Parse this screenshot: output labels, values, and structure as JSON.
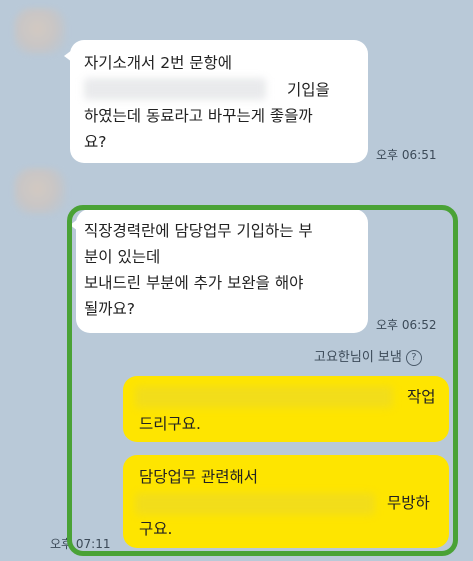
{
  "messages": [
    {
      "lines": [
        "자기소개서 2번 문항에",
        "기입을",
        "하였는데 동료라고 바꾸는게 좋을까",
        "요?"
      ],
      "time": "오후 06:51"
    },
    {
      "lines": [
        "직장경력란에 담당업무 기입하는 부",
        "분이 있는데",
        "보내드린 부분에 추가 보완을 해야",
        "될까요?"
      ],
      "time": "오후 06:52"
    }
  ],
  "sent_by_note": "고요한님이 보냄",
  "help_icon": "question-circle-icon",
  "replies": [
    {
      "lines": [
        "작업",
        "드리구요."
      ]
    },
    {
      "lines": [
        "담당업무 관련해서",
        "무방하",
        "구요."
      ]
    }
  ],
  "reply_time": "오후 07:11",
  "colors": {
    "background": "#b9c9d8",
    "bubble_in": "#ffffff",
    "bubble_out": "#fee500",
    "highlight": "#4aa236"
  }
}
